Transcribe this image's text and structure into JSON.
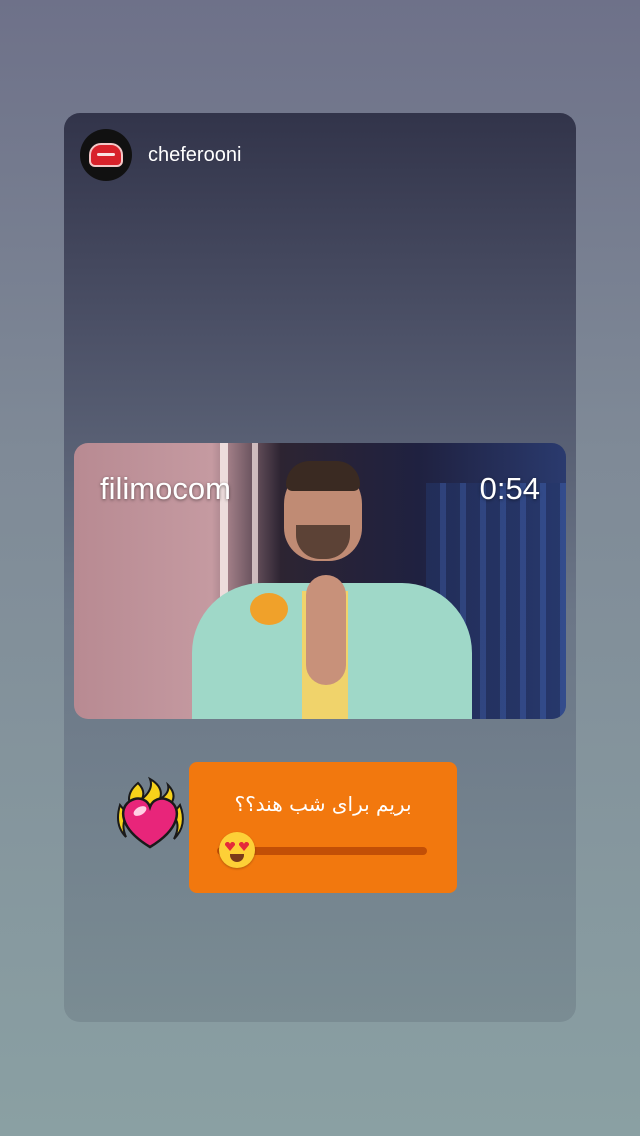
{
  "header": {
    "username": "cheferooni",
    "avatar_icon": "chef-hat-icon"
  },
  "video": {
    "brand": "filimocom",
    "time": "0:54"
  },
  "poll": {
    "question": "بریم برای شب هند؟؟",
    "slider_icon": "heart-eyes-emoji-icon",
    "slider_value": 0,
    "color": "#f2780e"
  },
  "sticker": {
    "icon": "flaming-heart-icon"
  }
}
